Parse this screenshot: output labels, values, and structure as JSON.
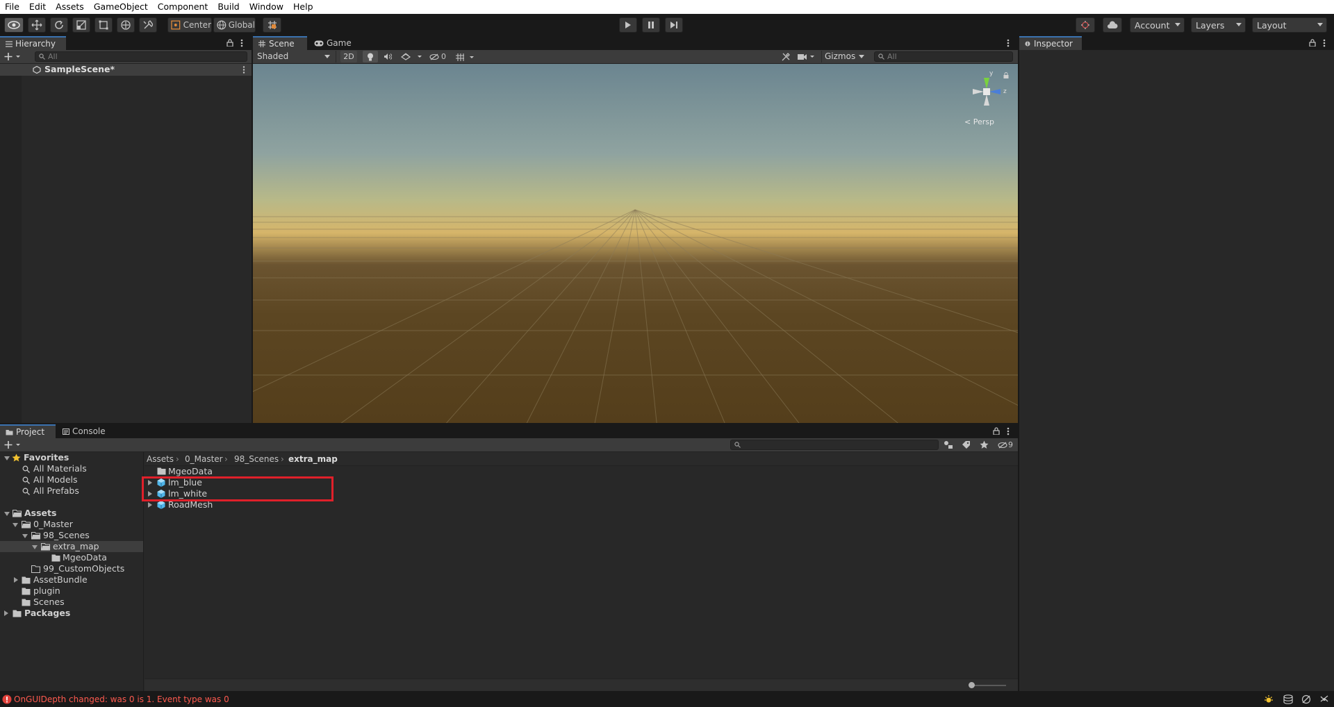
{
  "menubar": {
    "items": [
      "File",
      "Edit",
      "Assets",
      "GameObject",
      "Component",
      "Build",
      "Window",
      "Help"
    ]
  },
  "toolbar": {
    "pivot_label": "Center",
    "space_label": "Global",
    "account_label": "Account",
    "layers_label": "Layers",
    "layout_label": "Layout"
  },
  "hierarchy": {
    "tab_label": "Hierarchy",
    "search_placeholder": "All",
    "scene_name": "SampleScene*"
  },
  "scene": {
    "tabs": [
      "Scene",
      "Game"
    ],
    "shading_mode": "Shaded",
    "mode_2d": "2D",
    "hidden_count": "0",
    "gizmos_label": "Gizmos",
    "search_placeholder": "All",
    "projection_label": "Persp",
    "axis_y": "y",
    "axis_z": "z"
  },
  "inspector": {
    "tab_label": "Inspector"
  },
  "project": {
    "tabs": [
      "Project",
      "Console"
    ],
    "visibility_count": "9",
    "breadcrumb": [
      "Assets",
      "0_Master",
      "98_Scenes",
      "extra_map"
    ],
    "favorites": {
      "label": "Favorites",
      "items": [
        "All Materials",
        "All Models",
        "All Prefabs"
      ]
    },
    "tree": {
      "assets_label": "Assets",
      "master": "0_Master",
      "scenes98": "98_Scenes",
      "extra_map": "extra_map",
      "mgeo": "MgeoData",
      "custom": "99_CustomObjects",
      "assetbundle": "AssetBundle",
      "plugin": "plugin",
      "scenes": "Scenes",
      "packages_label": "Packages"
    },
    "files": [
      {
        "name": "MgeoData",
        "kind": "folder"
      },
      {
        "name": "lm_blue",
        "kind": "prefab"
      },
      {
        "name": "lm_white",
        "kind": "prefab"
      },
      {
        "name": "RoadMesh",
        "kind": "prefab"
      }
    ],
    "highlight_color": "#e0202a"
  },
  "status": {
    "error_message": "OnGUIDepth changed: was 0 is 1. Event type was 0",
    "error_color": "#ff5a4f"
  }
}
